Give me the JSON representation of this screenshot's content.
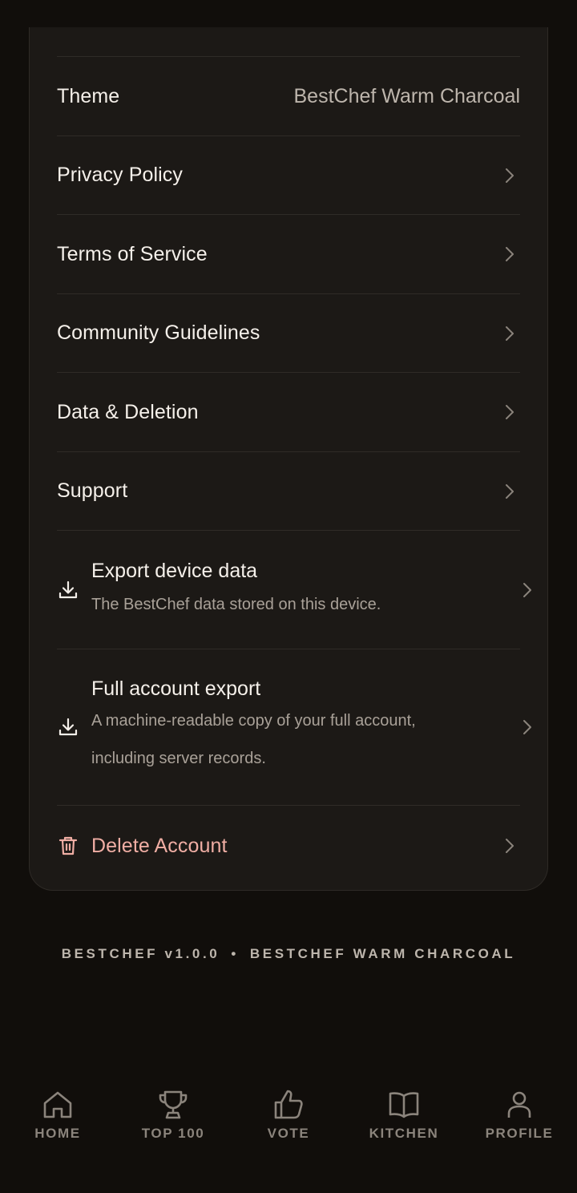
{
  "settings": {
    "theme": {
      "label": "Theme",
      "value": "BestChef Warm Charcoal"
    },
    "privacy_policy": "Privacy Policy",
    "terms_of_service": "Terms of Service",
    "community_guidelines": "Community Guidelines",
    "data_deletion": "Data & Deletion",
    "support": "Support",
    "export_device": {
      "title": "Export device data",
      "subtitle": "The BestChef data stored on this device."
    },
    "full_export": {
      "title": "Full account export",
      "subtitle_line1": "A machine-readable copy of your full account,",
      "subtitle_line2": "including server records."
    },
    "delete_account": "Delete Account"
  },
  "footer": {
    "version": "BESTCHEF v1.0.0",
    "separator": "•",
    "theme_name": "BESTCHEF WARM CHARCOAL"
  },
  "tabbar": {
    "items": [
      {
        "label": "HOME",
        "icon": "home-icon"
      },
      {
        "label": "TOP 100",
        "icon": "trophy-icon"
      },
      {
        "label": "VOTE",
        "icon": "thumbs-up-icon"
      },
      {
        "label": "KITCHEN",
        "icon": "book-icon"
      },
      {
        "label": "PROFILE",
        "icon": "person-icon"
      }
    ]
  },
  "colors": {
    "background": "#110e0b",
    "card": "#1c1916",
    "danger": "#f0aea4",
    "muted": "#8b847c"
  }
}
